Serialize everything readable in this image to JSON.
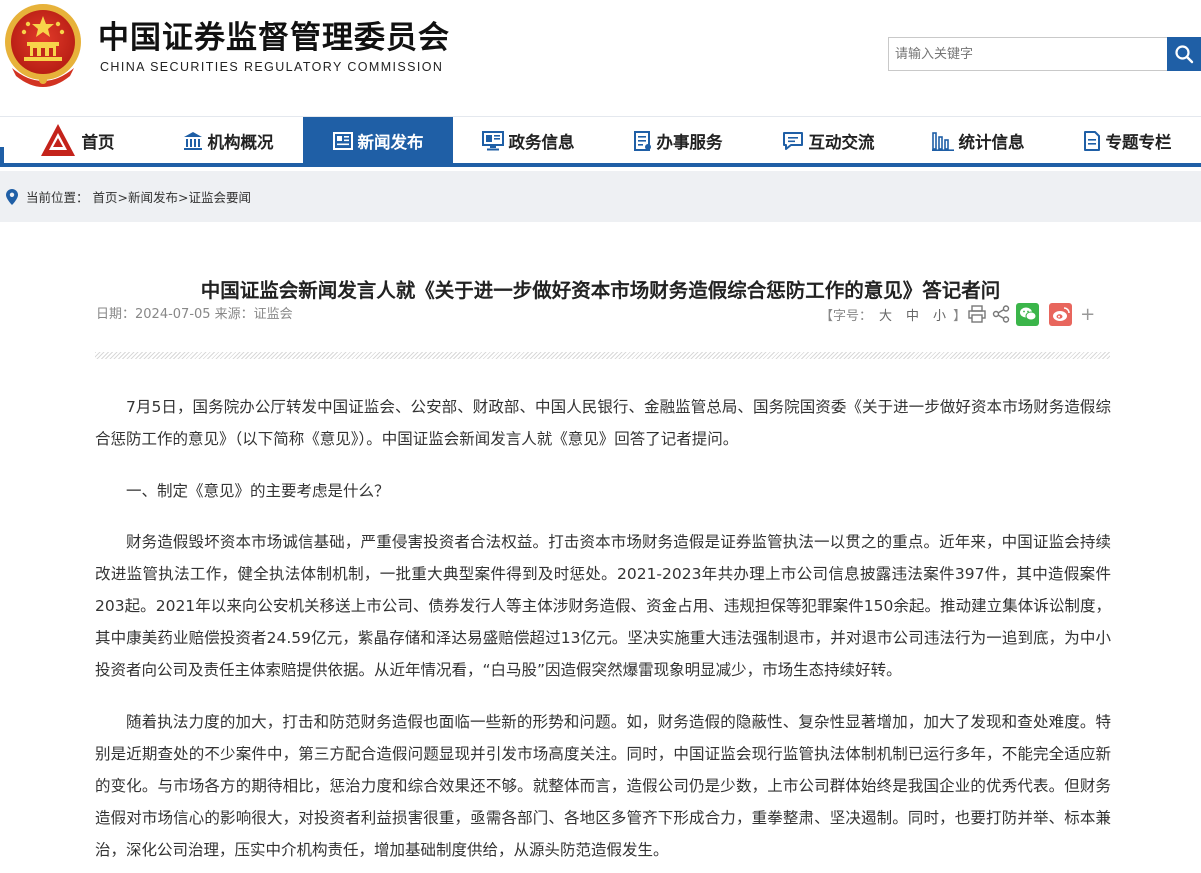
{
  "header": {
    "title_cn": "中国证券监督管理委员会",
    "title_en": "CHINA SECURITIES REGULATORY COMMISSION",
    "search_placeholder": "请输入关键字",
    "brand_color": "#1f5fa6",
    "emblem_icon": "national-emblem-icon"
  },
  "nav": {
    "items": [
      {
        "label": "首页",
        "icon": "csrc-logo-icon",
        "active": false
      },
      {
        "label": "机构概况",
        "icon": "building-icon",
        "active": false
      },
      {
        "label": "新闻发布",
        "icon": "newspaper-icon",
        "active": true
      },
      {
        "label": "政务信息",
        "icon": "monitor-icon",
        "active": false
      },
      {
        "label": "办事服务",
        "icon": "document-list-icon",
        "active": false
      },
      {
        "label": "互动交流",
        "icon": "chat-icon",
        "active": false
      },
      {
        "label": "统计信息",
        "icon": "bar-chart-icon",
        "active": false
      },
      {
        "label": "专题专栏",
        "icon": "topic-doc-icon",
        "active": false
      }
    ]
  },
  "breadcrumb": {
    "prefix": "当前位置：",
    "path": "首页>新闻发布>证监会要闻"
  },
  "article": {
    "title": "中国证监会新闻发言人就《关于进一步做好资本市场财务造假综合惩防工作的意见》答记者问",
    "meta": "日期：2024-07-05 来源：证监会",
    "font_size_label": "【字号：",
    "font_sizes": [
      "大",
      "中",
      "小"
    ],
    "font_size_close": "】",
    "plus": "+",
    "paragraphs": [
      "7月5日，国务院办公厅转发中国证监会、公安部、财政部、中国人民银行、金融监管总局、国务院国资委《关于进一步做好资本市场财务造假综合惩防工作的意见》（以下简称《意见》）。中国证监会新闻发言人就《意见》回答了记者提问。",
      "一、制定《意见》的主要考虑是什么？",
      "财务造假毁坏资本市场诚信基础，严重侵害投资者合法权益。打击资本市场财务造假是证券监管执法一以贯之的重点。近年来，中国证监会持续改进监管执法工作，健全执法体制机制，一批重大典型案件得到及时惩处。2021-2023年共办理上市公司信息披露违法案件397件，其中造假案件203起。2021年以来向公安机关移送上市公司、债券发行人等主体涉财务造假、资金占用、违规担保等犯罪案件150余起。推动建立集体诉讼制度，其中康美药业赔偿投资者24.59亿元，紫晶存储和泽达易盛赔偿超过13亿元。坚决实施重大违法强制退市，并对退市公司违法行为一追到底，为中小投资者向公司及责任主体索赔提供依据。从近年情况看，“白马股”因造假突然爆雷现象明显减少，市场生态持续好转。",
      "随着执法力度的加大，打击和防范财务造假也面临一些新的形势和问题。如，财务造假的隐蔽性、复杂性显著增加，加大了发现和查处难度。特别是近期查处的不少案件中，第三方配合造假问题显现并引发市场高度关注。同时，中国证监会现行监管执法体制机制已运行多年，不能完全适应新的变化。与市场各方的期待相比，惩治力度和综合效果还不够。就整体而言，造假公司仍是少数，上市公司群体始终是我国企业的优秀代表。但财务造假对市场信心的影响很大，对投资者利益损害很重，亟需各部门、各地区多管齐下形成合力，重拳整肃、坚决遏制。同时，也要打防并举、标本兼治，深化公司治理，压实中介机构责任，增加基础制度供给，从源头防范造假发生。"
    ]
  }
}
